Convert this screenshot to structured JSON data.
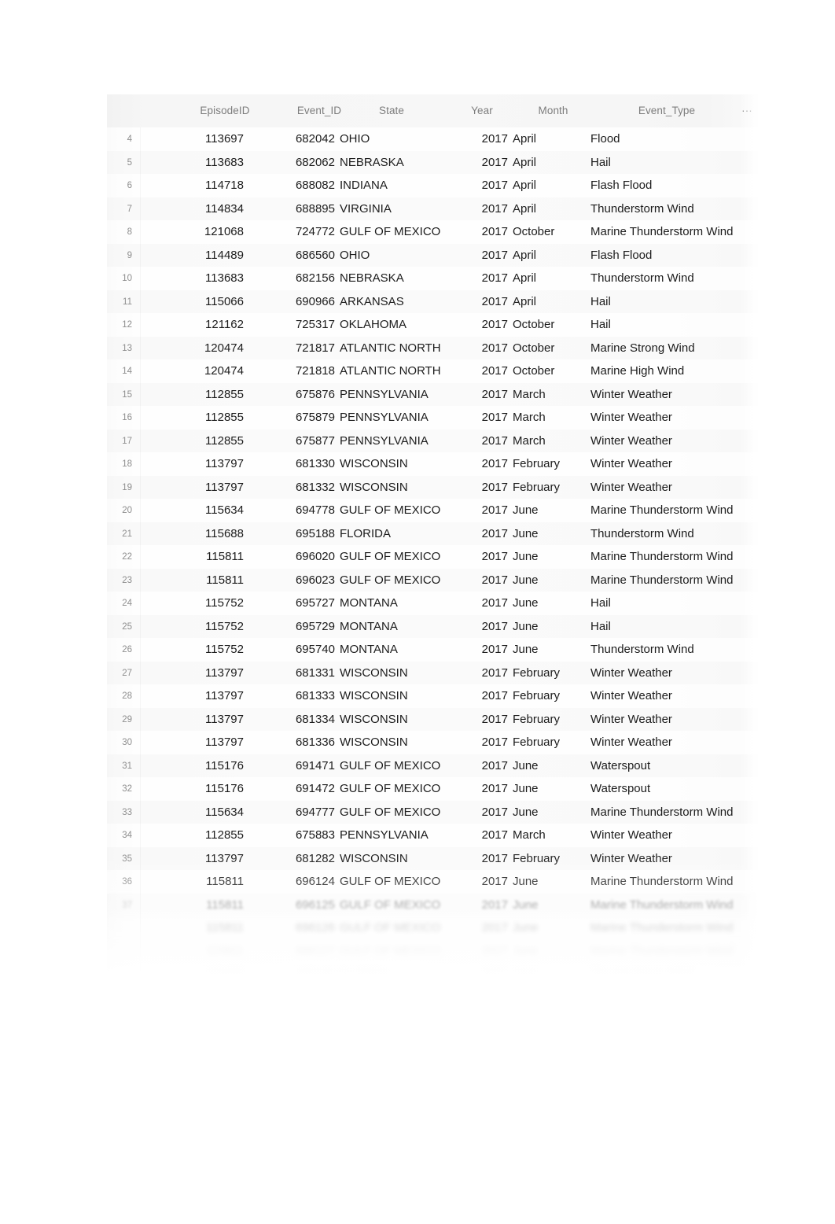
{
  "grid": {
    "more_menu_label": "···",
    "columns": [
      {
        "key": "episode_id",
        "label": "EpisodeID"
      },
      {
        "key": "event_id",
        "label": "Event_ID"
      },
      {
        "key": "state",
        "label": "State"
      },
      {
        "key": "year",
        "label": "Year"
      },
      {
        "key": "month",
        "label": "Month"
      },
      {
        "key": "event_type",
        "label": "Event_Type"
      }
    ],
    "rows": [
      {
        "n": "4",
        "episode_id": "113697",
        "event_id": "682042",
        "state": "OHIO",
        "year": "2017",
        "month": "April",
        "event_type": "Flood"
      },
      {
        "n": "5",
        "episode_id": "113683",
        "event_id": "682062",
        "state": "NEBRASKA",
        "year": "2017",
        "month": "April",
        "event_type": "Hail"
      },
      {
        "n": "6",
        "episode_id": "114718",
        "event_id": "688082",
        "state": "INDIANA",
        "year": "2017",
        "month": "April",
        "event_type": "Flash Flood"
      },
      {
        "n": "7",
        "episode_id": "114834",
        "event_id": "688895",
        "state": "VIRGINIA",
        "year": "2017",
        "month": "April",
        "event_type": "Thunderstorm Wind"
      },
      {
        "n": "8",
        "episode_id": "121068",
        "event_id": "724772",
        "state": "GULF OF MEXICO",
        "year": "2017",
        "month": "October",
        "event_type": "Marine Thunderstorm Wind"
      },
      {
        "n": "9",
        "episode_id": "114489",
        "event_id": "686560",
        "state": "OHIO",
        "year": "2017",
        "month": "April",
        "event_type": "Flash Flood"
      },
      {
        "n": "10",
        "episode_id": "113683",
        "event_id": "682156",
        "state": "NEBRASKA",
        "year": "2017",
        "month": "April",
        "event_type": "Thunderstorm Wind"
      },
      {
        "n": "11",
        "episode_id": "115066",
        "event_id": "690966",
        "state": "ARKANSAS",
        "year": "2017",
        "month": "April",
        "event_type": "Hail"
      },
      {
        "n": "12",
        "episode_id": "121162",
        "event_id": "725317",
        "state": "OKLAHOMA",
        "year": "2017",
        "month": "October",
        "event_type": "Hail"
      },
      {
        "n": "13",
        "episode_id": "120474",
        "event_id": "721817",
        "state": "ATLANTIC NORTH",
        "year": "2017",
        "month": "October",
        "event_type": "Marine Strong Wind"
      },
      {
        "n": "14",
        "episode_id": "120474",
        "event_id": "721818",
        "state": "ATLANTIC NORTH",
        "year": "2017",
        "month": "October",
        "event_type": "Marine High Wind"
      },
      {
        "n": "15",
        "episode_id": "112855",
        "event_id": "675876",
        "state": "PENNSYLVANIA",
        "year": "2017",
        "month": "March",
        "event_type": "Winter Weather"
      },
      {
        "n": "16",
        "episode_id": "112855",
        "event_id": "675879",
        "state": "PENNSYLVANIA",
        "year": "2017",
        "month": "March",
        "event_type": "Winter Weather"
      },
      {
        "n": "17",
        "episode_id": "112855",
        "event_id": "675877",
        "state": "PENNSYLVANIA",
        "year": "2017",
        "month": "March",
        "event_type": "Winter Weather"
      },
      {
        "n": "18",
        "episode_id": "113797",
        "event_id": "681330",
        "state": "WISCONSIN",
        "year": "2017",
        "month": "February",
        "event_type": "Winter Weather"
      },
      {
        "n": "19",
        "episode_id": "113797",
        "event_id": "681332",
        "state": "WISCONSIN",
        "year": "2017",
        "month": "February",
        "event_type": "Winter Weather"
      },
      {
        "n": "20",
        "episode_id": "115634",
        "event_id": "694778",
        "state": "GULF OF MEXICO",
        "year": "2017",
        "month": "June",
        "event_type": "Marine Thunderstorm Wind"
      },
      {
        "n": "21",
        "episode_id": "115688",
        "event_id": "695188",
        "state": "FLORIDA",
        "year": "2017",
        "month": "June",
        "event_type": "Thunderstorm Wind"
      },
      {
        "n": "22",
        "episode_id": "115811",
        "event_id": "696020",
        "state": "GULF OF MEXICO",
        "year": "2017",
        "month": "June",
        "event_type": "Marine Thunderstorm Wind"
      },
      {
        "n": "23",
        "episode_id": "115811",
        "event_id": "696023",
        "state": "GULF OF MEXICO",
        "year": "2017",
        "month": "June",
        "event_type": "Marine Thunderstorm Wind"
      },
      {
        "n": "24",
        "episode_id": "115752",
        "event_id": "695727",
        "state": "MONTANA",
        "year": "2017",
        "month": "June",
        "event_type": "Hail"
      },
      {
        "n": "25",
        "episode_id": "115752",
        "event_id": "695729",
        "state": "MONTANA",
        "year": "2017",
        "month": "June",
        "event_type": "Hail"
      },
      {
        "n": "26",
        "episode_id": "115752",
        "event_id": "695740",
        "state": "MONTANA",
        "year": "2017",
        "month": "June",
        "event_type": "Thunderstorm Wind"
      },
      {
        "n": "27",
        "episode_id": "113797",
        "event_id": "681331",
        "state": "WISCONSIN",
        "year": "2017",
        "month": "February",
        "event_type": "Winter Weather"
      },
      {
        "n": "28",
        "episode_id": "113797",
        "event_id": "681333",
        "state": "WISCONSIN",
        "year": "2017",
        "month": "February",
        "event_type": "Winter Weather"
      },
      {
        "n": "29",
        "episode_id": "113797",
        "event_id": "681334",
        "state": "WISCONSIN",
        "year": "2017",
        "month": "February",
        "event_type": "Winter Weather"
      },
      {
        "n": "30",
        "episode_id": "113797",
        "event_id": "681336",
        "state": "WISCONSIN",
        "year": "2017",
        "month": "February",
        "event_type": "Winter Weather"
      },
      {
        "n": "31",
        "episode_id": "115176",
        "event_id": "691471",
        "state": "GULF OF MEXICO",
        "year": "2017",
        "month": "June",
        "event_type": "Waterspout"
      },
      {
        "n": "32",
        "episode_id": "115176",
        "event_id": "691472",
        "state": "GULF OF MEXICO",
        "year": "2017",
        "month": "June",
        "event_type": "Waterspout"
      },
      {
        "n": "33",
        "episode_id": "115634",
        "event_id": "694777",
        "state": "GULF OF MEXICO",
        "year": "2017",
        "month": "June",
        "event_type": "Marine Thunderstorm Wind"
      },
      {
        "n": "34",
        "episode_id": "112855",
        "event_id": "675883",
        "state": "PENNSYLVANIA",
        "year": "2017",
        "month": "March",
        "event_type": "Winter Weather"
      },
      {
        "n": "35",
        "episode_id": "113797",
        "event_id": "681282",
        "state": "WISCONSIN",
        "year": "2017",
        "month": "February",
        "event_type": "Winter Weather"
      },
      {
        "n": "36",
        "episode_id": "115811",
        "event_id": "696124",
        "state": "GULF OF MEXICO",
        "year": "2017",
        "month": "June",
        "event_type": "Marine Thunderstorm Wind"
      },
      {
        "n": "37",
        "episode_id": "115811",
        "event_id": "696125",
        "state": "GULF OF MEXICO",
        "year": "2017",
        "month": "June",
        "event_type": "Marine Thunderstorm Wind",
        "blur": 1
      },
      {
        "n": "",
        "episode_id": "115811",
        "event_id": "696126",
        "state": "GULF OF MEXICO",
        "year": "2017",
        "month": "June",
        "event_type": "Marine Thunderstorm Wind",
        "blur": 2
      },
      {
        "n": "",
        "episode_id": "115811",
        "event_id": "696127",
        "state": "GULF OF MEXICO",
        "year": "2017",
        "month": "June",
        "event_type": "Marine Thunderstorm Wind",
        "blur": 3
      },
      {
        "n": "",
        "episode_id": "115688",
        "event_id": "695190",
        "state": "FLORIDA",
        "year": "2017",
        "month": "June",
        "event_type": "Thunderstorm Wind",
        "blur": 4
      }
    ]
  },
  "colors": {
    "page_background": "#ffffff",
    "grid_surface": "#fcfcfc",
    "header_background": "#f5f5f5",
    "header_text": "#7d7d7d",
    "cell_text": "#1c1c1c",
    "row_number_text": "#8e8e8e"
  }
}
